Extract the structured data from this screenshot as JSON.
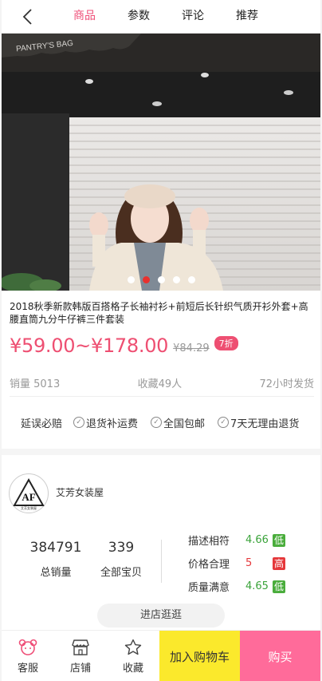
{
  "nav": {
    "tabs": [
      {
        "label": "商品",
        "active": true
      },
      {
        "label": "参数",
        "active": false
      },
      {
        "label": "评论",
        "active": false
      },
      {
        "label": "推荐",
        "active": false
      }
    ]
  },
  "hero": {
    "awning_text": "PANTRY'S BAG",
    "slide_count": 5,
    "active_slide": 2
  },
  "product": {
    "title": "2018秋季新款韩版百搭格子长袖衬衫+前短后长针织气质开衫外套+高腰直筒九分牛仔裤三件套装",
    "price": "¥59.00~¥178.00",
    "original_price": "¥84.29",
    "discount": "7折",
    "sales": "销量 5013",
    "favorites": "收藏49人",
    "shipping": "72小时发货"
  },
  "guarantees": {
    "first": "延误必赔",
    "items": [
      "退货补运费",
      "全国包邮",
      "7天无理由退货"
    ]
  },
  "shop": {
    "logo_text": "AF",
    "logo_subtext": "艾芳女装屋",
    "name": "艾芳女装屋",
    "total_sales": "384791",
    "total_sales_label": "总销量",
    "all_items": "339",
    "all_items_label": "全部宝贝",
    "ratings": [
      {
        "label": "描述相符",
        "score": "4.66",
        "level": "低",
        "score_color": "#3aa33a",
        "tag_color": "#4aad3c"
      },
      {
        "label": "价格合理",
        "score": "5",
        "level": "高",
        "score_color": "#e5383b",
        "tag_color": "#e5383b"
      },
      {
        "label": "质量满意",
        "score": "4.65",
        "level": "低",
        "score_color": "#3aa33a",
        "tag_color": "#4aad3c"
      }
    ],
    "visit_label": "进店逛逛"
  },
  "bottom_bar": {
    "service_label": "客服",
    "store_label": "店铺",
    "favorite_label": "收藏",
    "cart_label": "加入购物车",
    "buy_label": "购买"
  },
  "colors": {
    "accent": "#ef4f78",
    "cart_button": "#fbe92c",
    "buy_button": "#ff6b9a"
  }
}
